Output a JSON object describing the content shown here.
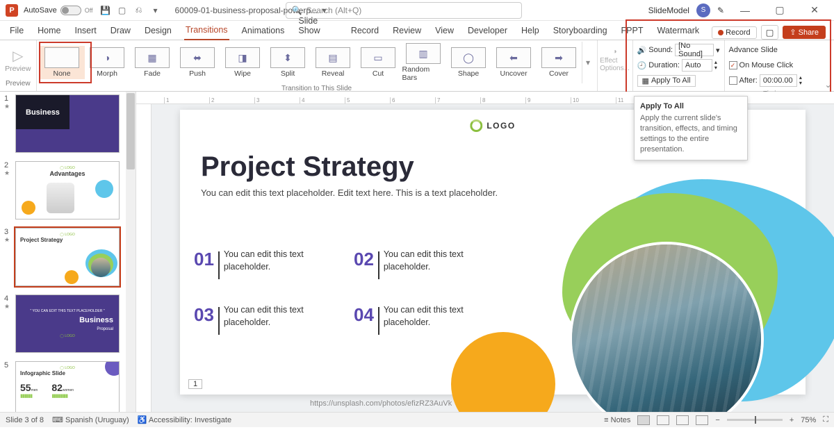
{
  "titlebar": {
    "autosave": "AutoSave",
    "autosave_state": "Off",
    "doc": "60009-01-business-proposal-powerp...",
    "search_ph": "Search (Alt+Q)",
    "brand": "SlideModel",
    "user": "S"
  },
  "tabs": [
    "File",
    "Home",
    "Insert",
    "Draw",
    "Design",
    "Transitions",
    "Animations",
    "Slide Show",
    "Record",
    "Review",
    "View",
    "Developer",
    "Help",
    "Storyboarding",
    "FPPT",
    "Watermark"
  ],
  "active_tab": "Transitions",
  "record": "Record",
  "share": "Share",
  "ribbon": {
    "preview": "Preview",
    "transitions": [
      {
        "name": "None"
      },
      {
        "name": "Morph"
      },
      {
        "name": "Fade"
      },
      {
        "name": "Push"
      },
      {
        "name": "Wipe"
      },
      {
        "name": "Split"
      },
      {
        "name": "Reveal"
      },
      {
        "name": "Cut"
      },
      {
        "name": "Random Bars"
      },
      {
        "name": "Shape"
      },
      {
        "name": "Uncover"
      },
      {
        "name": "Cover"
      }
    ],
    "group_trans": "Transition to This Slide",
    "effect": "Effect Options...",
    "sound": "Sound:",
    "sound_val": "[No Sound]",
    "duration": "Duration:",
    "duration_val": "Auto",
    "apply": "Apply To All",
    "advance": "Advance Slide",
    "on_click": "On Mouse Click",
    "after": "After:",
    "after_val": "00:00.00",
    "group_timing": "Timing"
  },
  "tooltip": {
    "title": "Apply To All",
    "body": "Apply the current slide's transition, effects, and timing settings to the entire presentation."
  },
  "thumbs": [
    {
      "n": "1",
      "title": "Business"
    },
    {
      "n": "2",
      "title": "Advantages"
    },
    {
      "n": "3",
      "title": "Project Strategy"
    },
    {
      "n": "4",
      "title": "Business Proposal"
    },
    {
      "n": "5",
      "title": "Infographic Slide"
    }
  ],
  "slide": {
    "logo": "LOGO",
    "title": "Project Strategy",
    "sub": "You can edit this text placeholder. Edit text here. This is a text placeholder.",
    "p": [
      "You can edit this text placeholder.",
      "You can edit this text placeholder.",
      "You can edit this text placeholder.",
      "You can edit this text placeholder."
    ],
    "nums": [
      "01",
      "02",
      "03",
      "04"
    ],
    "pagenum": "1",
    "url": "https://unsplash.com/photos/efizRZ3AuVk",
    "t5a": "55",
    "t5a_l": "men",
    "t5b": "82",
    "t5b_l": "women"
  },
  "status": {
    "slide": "Slide 3 of 8",
    "lang": "Spanish (Uruguay)",
    "access": "Accessibility: Investigate",
    "notes": "Notes",
    "zoom": "75%"
  }
}
